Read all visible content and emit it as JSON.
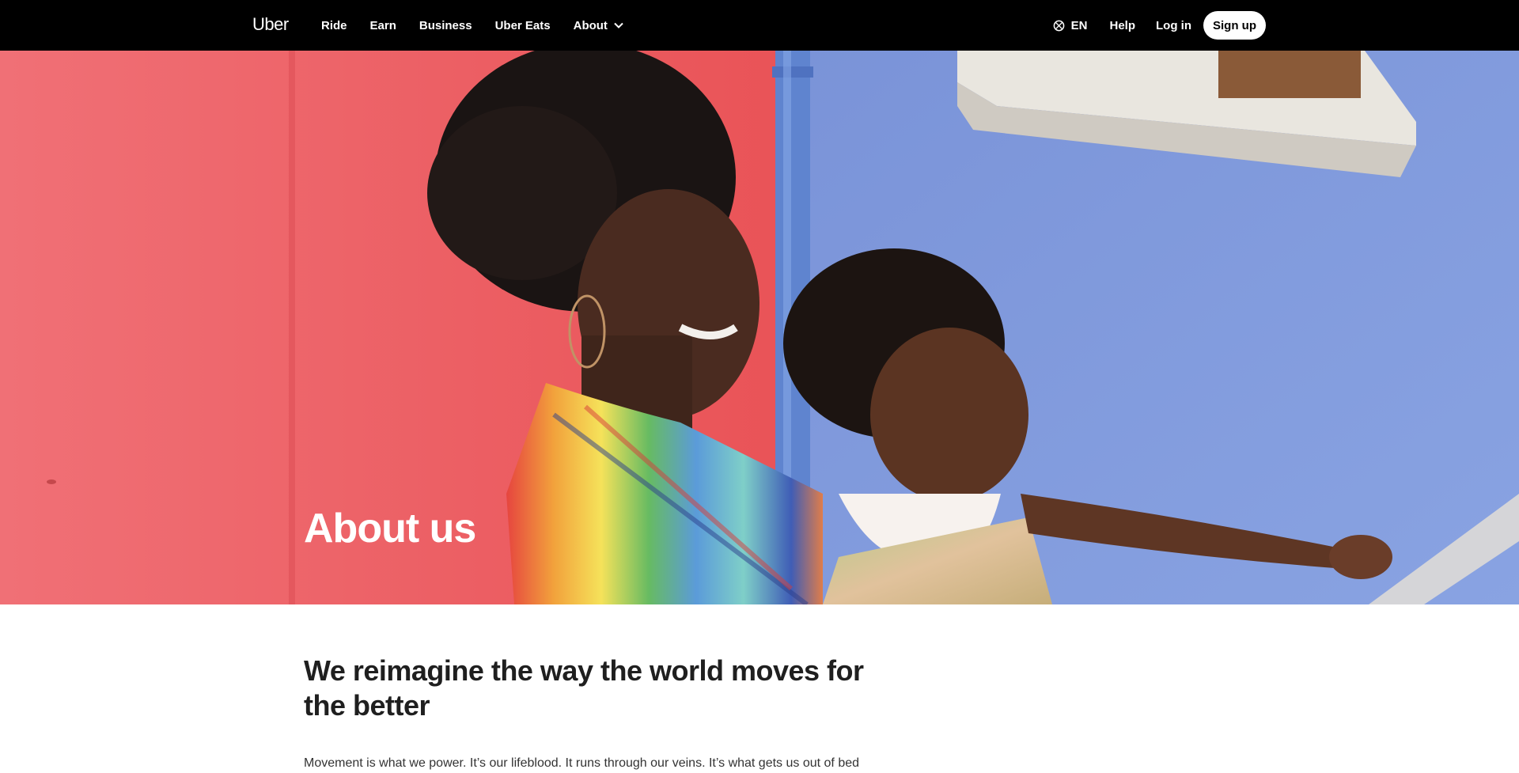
{
  "nav": {
    "logo": "Uber",
    "links": [
      {
        "label": "Ride"
      },
      {
        "label": "Earn"
      },
      {
        "label": "Business"
      },
      {
        "label": "Uber Eats"
      },
      {
        "label": "About"
      }
    ],
    "language": "EN",
    "help": "Help",
    "login": "Log in",
    "signup": "Sign up"
  },
  "hero": {
    "title": "About us",
    "image_alt": "Woman holding a smiling child in front of red and blue walls"
  },
  "content": {
    "heading": "We reimagine the way the world moves for the better",
    "body": "Movement is what we power. It’s our lifeblood. It runs through our veins. It’s what gets us out of bed"
  },
  "colors": {
    "nav_bg": "#000000",
    "nav_text": "#ffffff",
    "wall_red": "#ee5a5e",
    "wall_blue": "#7d98dc",
    "heading_text": "#1f1f1f"
  }
}
